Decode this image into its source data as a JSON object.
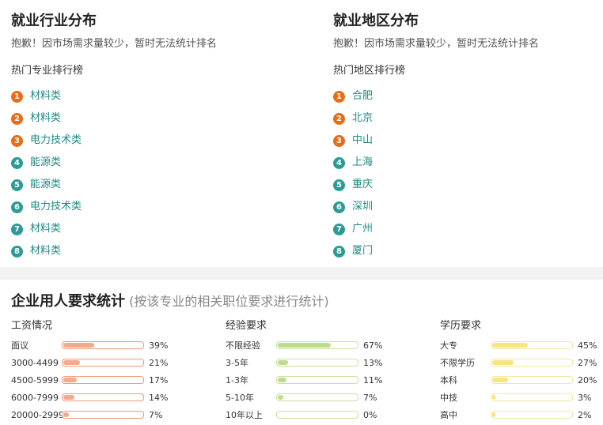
{
  "industry": {
    "title": "就业行业分布",
    "note": "抱歉！因市场需求量较少，暂时无法统计排名",
    "subtitle": "热门专业排行榜",
    "items": [
      "材料类",
      "材料类",
      "电力技术类",
      "能源类",
      "能源类",
      "电力技术类",
      "材料类",
      "材料类"
    ]
  },
  "region": {
    "title": "就业地区分布",
    "note": "抱歉！因市场需求量较少，暂时无法统计排名",
    "subtitle": "热门地区排行榜",
    "items": [
      "合肥",
      "北京",
      "中山",
      "上海",
      "重庆",
      "深圳",
      "广州",
      "厦门"
    ]
  },
  "rank_numbers": [
    "1",
    "2",
    "3",
    "4",
    "5",
    "6",
    "7",
    "8"
  ],
  "colors": {
    "rank_hot": "#ec6b15",
    "rank_normal": "#2a9c96",
    "link": "#1f8a84",
    "salary_bar": "#f5a88c",
    "salary_border": "#f09a7c",
    "experience_bar": "#bfdc8e",
    "experience_border": "#c9e0a2",
    "education_bar": "#f8e57e",
    "education_border": "#f3e7a5"
  },
  "stats": {
    "title": "企业用人要求统计",
    "note": "(按该专业的相关职位要求进行统计)",
    "salary": {
      "label": "工资情况",
      "rows": [
        {
          "name": "面议",
          "pct": "39%",
          "value": 39
        },
        {
          "name": "3000-4499",
          "pct": "21%",
          "value": 21
        },
        {
          "name": "4500-5999",
          "pct": "17%",
          "value": 17
        },
        {
          "name": "6000-7999",
          "pct": "14%",
          "value": 14
        },
        {
          "name": "20000-29999",
          "pct": "7%",
          "value": 7
        }
      ]
    },
    "experience": {
      "label": "经验要求",
      "rows": [
        {
          "name": "不限经验",
          "pct": "67%",
          "value": 67
        },
        {
          "name": "3-5年",
          "pct": "13%",
          "value": 13
        },
        {
          "name": "1-3年",
          "pct": "11%",
          "value": 11
        },
        {
          "name": "5-10年",
          "pct": "7%",
          "value": 7
        },
        {
          "name": "10年以上",
          "pct": "0%",
          "value": 0
        }
      ]
    },
    "education": {
      "label": "学历要求",
      "rows": [
        {
          "name": "大专",
          "pct": "45%",
          "value": 45
        },
        {
          "name": "不限学历",
          "pct": "27%",
          "value": 27
        },
        {
          "name": "本科",
          "pct": "20%",
          "value": 20
        },
        {
          "name": "中技",
          "pct": "3%",
          "value": 3
        },
        {
          "name": "高中",
          "pct": "2%",
          "value": 2
        }
      ]
    }
  }
}
